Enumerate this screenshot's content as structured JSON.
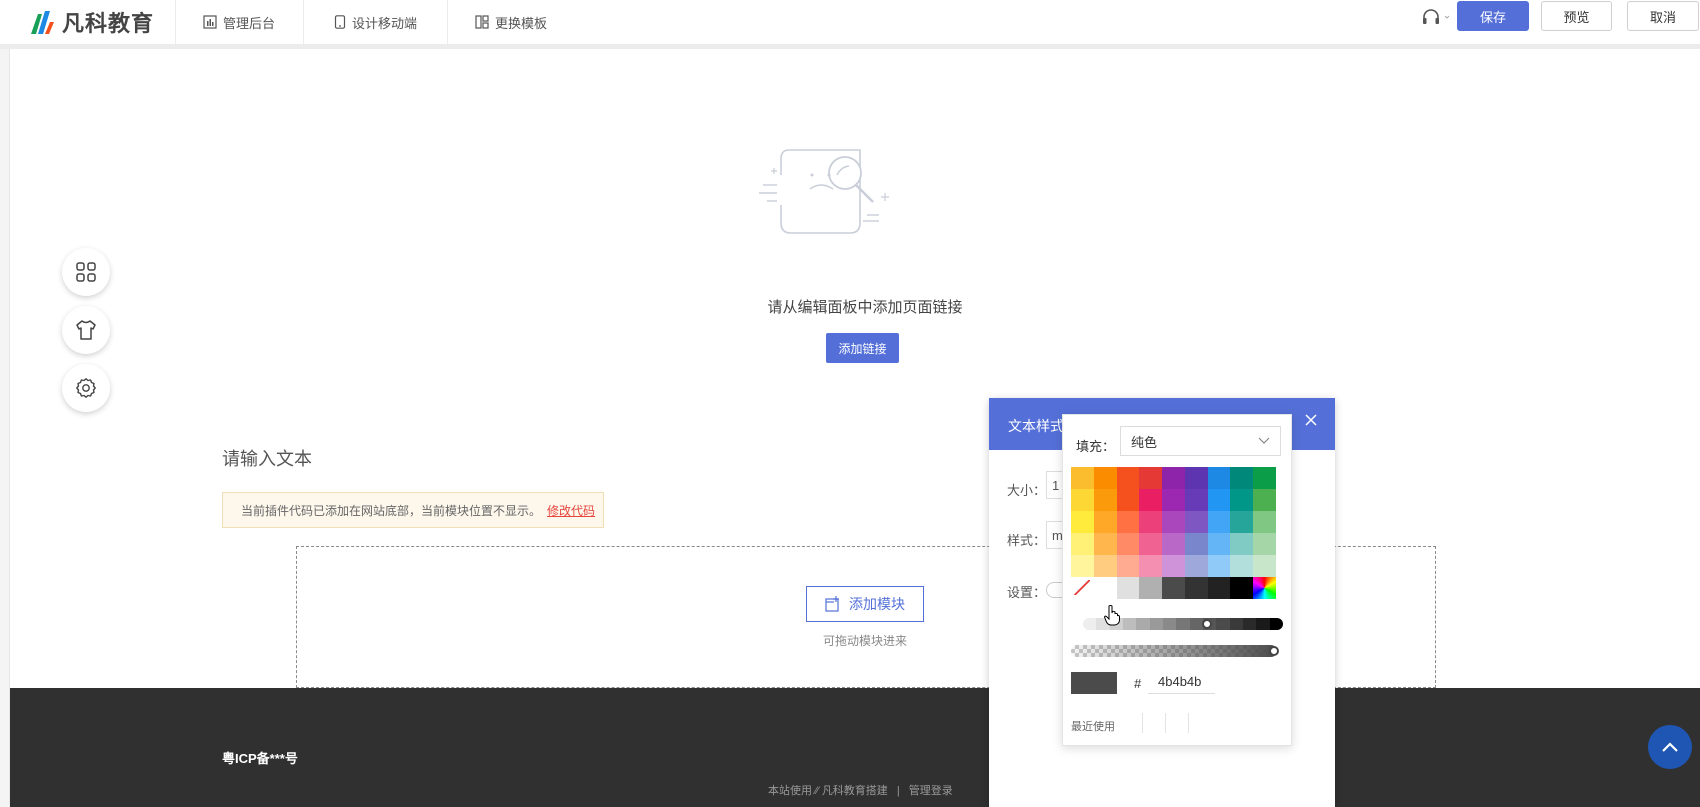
{
  "header": {
    "logo_text": "凡科教育",
    "nav": [
      {
        "label": "管理后台",
        "icon": "bar-chart-icon"
      },
      {
        "label": "设计移动端",
        "icon": "mobile-icon"
      },
      {
        "label": "更换模板",
        "icon": "template-icon"
      }
    ],
    "support_icon": "headset-icon",
    "save_label": "保存",
    "preview_label": "预览",
    "cancel_label": "取消"
  },
  "side_tools": [
    {
      "icon": "modules-grid-icon"
    },
    {
      "icon": "theme-shirt-icon"
    },
    {
      "icon": "settings-gear-icon"
    }
  ],
  "canvas": {
    "empty_message": "请从编辑面板中添加页面链接",
    "add_link_label": "添加链接",
    "text_placeholder_title": "请输入文本",
    "notice_text": "当前插件代码已添加在网站底部，当前模块位置不显示。",
    "notice_link": "修改代码",
    "add_module_label": "添加模块",
    "drag_hint": "可拖动模块进来"
  },
  "footer": {
    "icp": "粤ICP备***号",
    "powered_prefix": "本站使用",
    "powered_brand": "凡科教育搭建",
    "separator": "|",
    "admin_login": "管理登录"
  },
  "text_style_panel": {
    "title": "文本样式",
    "size_label": "大小：",
    "size_value": "1",
    "style_label": "样式：",
    "style_value": "m",
    "settings_label": "设置："
  },
  "color_picker": {
    "fill_label": "填充：",
    "fill_mode": "纯色",
    "hex_prefix": "#",
    "hex_value": "4b4b4b",
    "recent_label": "最近使用",
    "selected_color": "#4b4b4b",
    "swatch_rows": [
      [
        "#fbbd2d",
        "#fb8c00",
        "#f4511e",
        "#e53935",
        "#8e24aa",
        "#5e35b1",
        "#1e88e5",
        "#00897b",
        "#0b9d48"
      ],
      [
        "#fdd835",
        "#fb9a0b",
        "#f4511e",
        "#e91e63",
        "#9c27b0",
        "#673ab7",
        "#2196f3",
        "#009688",
        "#4caf50"
      ],
      [
        "#ffeb3b",
        "#ffa726",
        "#ff7043",
        "#ec407a",
        "#ab47bc",
        "#7e57c2",
        "#42a5f5",
        "#26a69a",
        "#81c784"
      ],
      [
        "#fff176",
        "#ffb74d",
        "#ff8a65",
        "#f06292",
        "#ba68c8",
        "#7986cb",
        "#64b5f6",
        "#80cbc4",
        "#a5d6a7"
      ],
      [
        "#fff59d",
        "#ffcc80",
        "#ffab91",
        "#f48fb1",
        "#ce93d8",
        "#9fa8da",
        "#90caf9",
        "#b2dfdb",
        "#c8e6c9"
      ],
      [
        "none",
        "#ffffff",
        "#e0e0e0",
        "#b0b0b0",
        "#4b4b4b",
        "#333333",
        "#222222",
        "#000000",
        "spectrum"
      ]
    ],
    "gray_steps": [
      "#eeeeee",
      "#e0e0e0",
      "#d0d0d0",
      "#bdbdbd",
      "#aaaaaa",
      "#9a9a9a",
      "#8a8a8a",
      "#777777",
      "#666666",
      "#555555",
      "#4b4b4b",
      "#3a3a3a",
      "#2a2a2a",
      "#1a1a1a",
      "#000000"
    ],
    "brightness_level": 0.62,
    "opacity_level": 1.0
  },
  "colors": {
    "accent": "#5470d8",
    "footer_bg": "#303030",
    "scroll_top": "#1f56b3",
    "notice_link": "#e6463e"
  }
}
